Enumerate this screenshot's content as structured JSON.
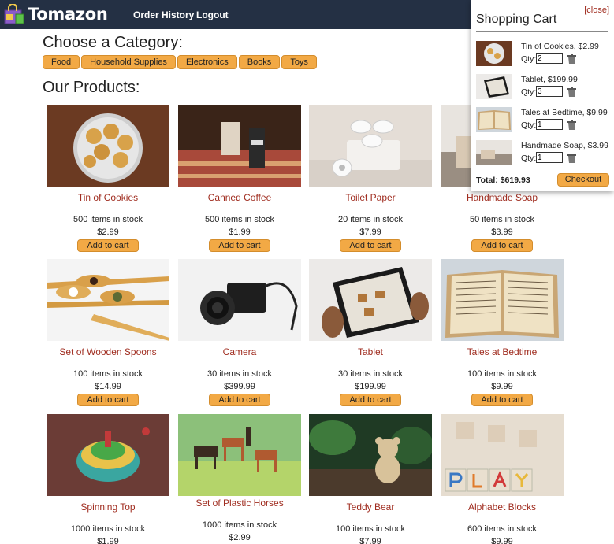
{
  "brand": {
    "name": "Tomazon",
    "color": "#243044",
    "accent": "#f2a945"
  },
  "nav": {
    "order_history": "Order History",
    "logout": "Logout"
  },
  "category_heading": "Choose a Category:",
  "categories": [
    "Food",
    "Household Supplies",
    "Electronics",
    "Books",
    "Toys"
  ],
  "products_heading": "Our Products:",
  "add_label": "Add to cart",
  "products": [
    {
      "name": "Tin of Cookies",
      "stock": "500 items in stock",
      "price": "$2.99"
    },
    {
      "name": "Canned Coffee",
      "stock": "500 items in stock",
      "price": "$1.99"
    },
    {
      "name": "Toilet Paper",
      "stock": "20 items in stock",
      "price": "$7.99"
    },
    {
      "name": "Handmade Soap",
      "stock": "50 items in stock",
      "price": "$3.99"
    },
    {
      "name": "Set of Wooden Spoons",
      "stock": "100 items in stock",
      "price": "$14.99"
    },
    {
      "name": "Camera",
      "stock": "30 items in stock",
      "price": "$399.99"
    },
    {
      "name": "Tablet",
      "stock": "30 items in stock",
      "price": "$199.99"
    },
    {
      "name": "Tales at Bedtime",
      "stock": "100 items in stock",
      "price": "$9.99"
    },
    {
      "name": "Spinning Top",
      "stock": "1000 items in stock",
      "price": "$1.99"
    },
    {
      "name": "Set of Plastic Horses",
      "stock": "1000 items in stock",
      "price": "$2.99"
    },
    {
      "name": "Teddy Bear",
      "stock": "100 items in stock",
      "price": "$7.99"
    },
    {
      "name": "Alphabet Blocks",
      "stock": "600 items in stock",
      "price": "$9.99"
    }
  ],
  "cart": {
    "close_label": "[close]",
    "title": "Shopping Cart",
    "qty_label": "Qty:",
    "items": [
      {
        "desc": "Tin of Cookies, $2.99",
        "qty": "2"
      },
      {
        "desc": "Tablet, $199.99",
        "qty": "3"
      },
      {
        "desc": "Tales at Bedtime, $9.99",
        "qty": "1"
      },
      {
        "desc": "Handmade Soap, $3.99",
        "qty": "1"
      }
    ],
    "total": "Total: $619.93",
    "checkout_label": "Checkout"
  }
}
